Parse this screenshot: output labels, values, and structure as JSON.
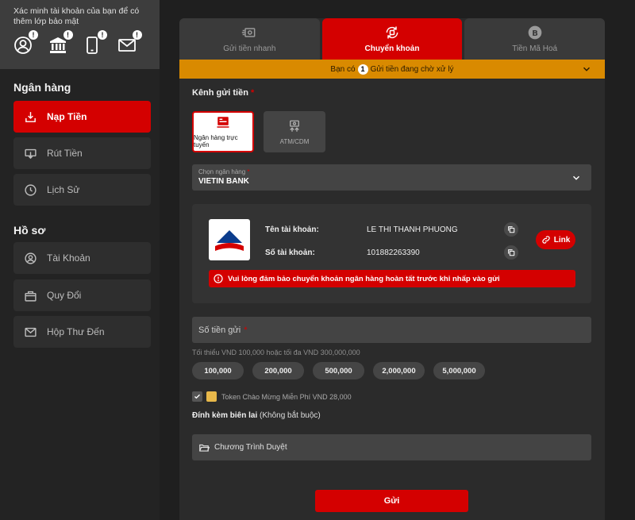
{
  "sidebar": {
    "verify_text": "Xác minh tài khoản của bạn để có thêm lớp bảo mật",
    "verify_icons": [
      {
        "icon": "user-icon",
        "badge": "!"
      },
      {
        "icon": "bank-icon",
        "badge": "!"
      },
      {
        "icon": "phone-icon",
        "badge": "!"
      },
      {
        "icon": "mail-icon",
        "badge": "!"
      }
    ],
    "section_bank": "Ngân hàng",
    "bank_items": [
      {
        "label": "Nạp Tiền",
        "icon": "deposit-icon",
        "active": true
      },
      {
        "label": "Rút Tiền",
        "icon": "withdraw-icon",
        "active": false
      },
      {
        "label": "Lịch Sử",
        "icon": "clock-icon",
        "active": false
      }
    ],
    "section_profile": "Hồ sơ",
    "profile_items": [
      {
        "label": "Tài Khoản",
        "icon": "account-icon"
      },
      {
        "label": "Quy Đổi",
        "icon": "gift-icon"
      },
      {
        "label": "Hộp Thư Đến",
        "icon": "inbox-icon"
      }
    ]
  },
  "tabs": [
    {
      "label": "Gửi tiền nhanh",
      "icon": "fast-money-icon",
      "active": false
    },
    {
      "label": "Chuyển khoản",
      "icon": "transfer-icon",
      "active": true
    },
    {
      "label": "Tiền Mã Hoá",
      "icon": "bitcoin-icon",
      "active": false
    }
  ],
  "pending": {
    "prefix": "Bạn có",
    "count": "1",
    "suffix": "Gửi tiền đang chờ xử lý"
  },
  "channel": {
    "label": "Kênh gửi tiền",
    "required": "*",
    "options": [
      {
        "label": "Ngân hàng trực tuyến",
        "active": true
      },
      {
        "label": "ATM/CDM",
        "active": false
      }
    ]
  },
  "bank_select": {
    "placeholder": "Chọn ngân hàng",
    "required": "*",
    "value": "VIETIN BANK"
  },
  "account": {
    "name_label": "Tên tài khoản:",
    "name_value": "LE THI THANH PHUONG",
    "number_label": "Số tài khoản:",
    "number_value": "101882263390",
    "link_label": "Link",
    "warning": "Vui lòng đảm bảo chuyển khoản ngân hàng hoàn tất trước khi nhấp vào gửi"
  },
  "amount": {
    "placeholder": "Số tiền gửi",
    "required": "*",
    "hint": "Tối thiểu VND 100,000 hoặc tối đa VND 300,000,000",
    "chips": [
      "100,000",
      "200,000",
      "500,000",
      "2,000,000",
      "5,000,000"
    ]
  },
  "token": {
    "label": "Token Chào Mừng Miễn Phí VND 28,000",
    "checked": true
  },
  "attach": {
    "label_bold": "Đính kèm biên lai",
    "label_rest": " (Không bắt buộc)",
    "browse": "Chương Trình Duyệt"
  },
  "submit_label": "Gửi",
  "colors": {
    "accent": "#d40000",
    "pending": "#d98a00",
    "background": "#1f1f1f"
  }
}
